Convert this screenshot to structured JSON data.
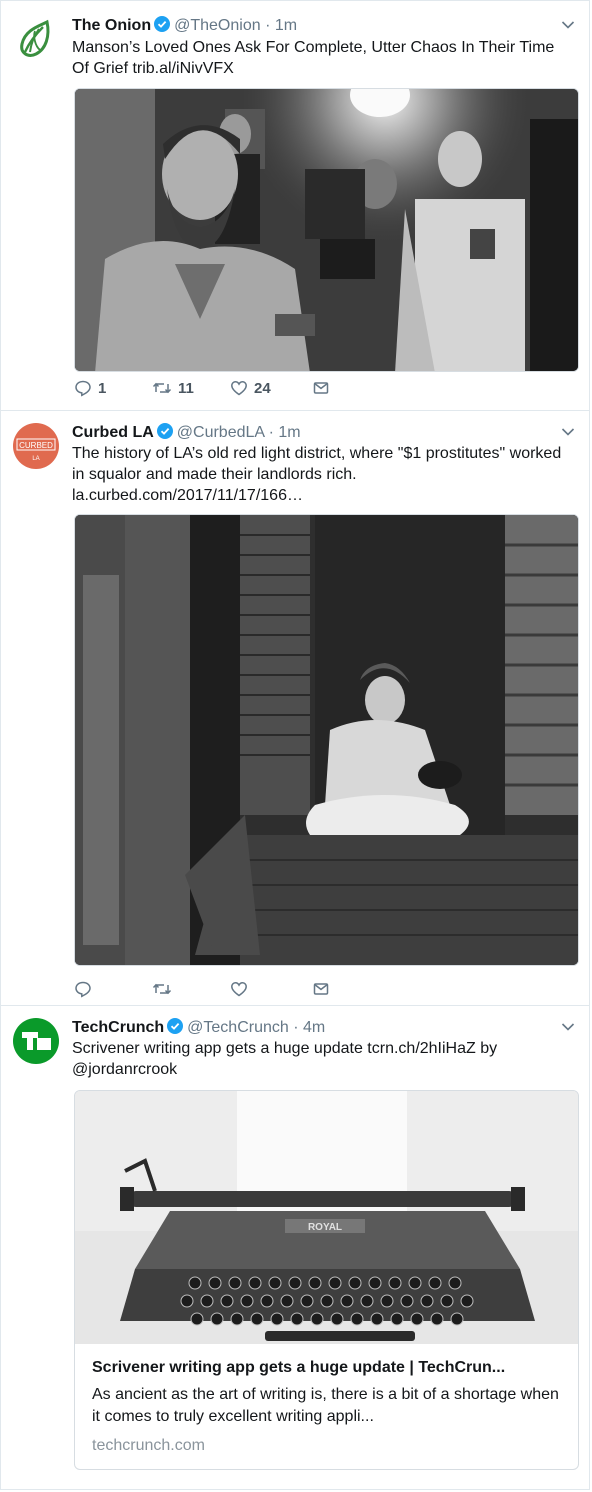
{
  "tweets": [
    {
      "name": "The Onion",
      "handle": "@TheOnion · 1m",
      "text": "Manson’s Loved Ones Ask For Complete, Utter Chaos In Their Time Of Grief ",
      "link": "trib.al/iNivVFX",
      "counts": {
        "reply": "1",
        "retweet": "11",
        "like": "24"
      }
    },
    {
      "name": "Curbed LA",
      "handle": "@CurbedLA · 1m",
      "text": "The history of LA’s old red light district, where \"$1 prostitutes\" worked in squalor and made their landlords rich. ",
      "link": "la.curbed.com/2017/11/17/166…",
      "avatar_top": "CURBED",
      "avatar_bottom": "LA"
    },
    {
      "name": "TechCrunch",
      "handle": "@TechCrunch · 4m",
      "text": "Scrivener writing app gets a huge update ",
      "link": "tcrn.ch/2hIiHaZ",
      "text_after": " by ",
      "mention": "@jordanrcrook",
      "avatar_logo": "TC",
      "card": {
        "title": "Scrivener writing app gets a huge update | TechCrun...",
        "description": "As ancient as the art of writing is, there is a bit of a shortage when it comes to truly excellent writing appli...",
        "domain": "techcrunch.com",
        "typewriter_brand": "ROYAL"
      }
    }
  ],
  "colors": {
    "onion_green": "#3a8f3f",
    "curbed_red": "#e06a4f",
    "techcrunch_green": "#0a9a2a",
    "verified_blue": "#1da1f2"
  },
  "icons": [
    "onion-logo-icon",
    "verified-icon",
    "chevron-down-icon",
    "reply-icon",
    "retweet-icon",
    "like-icon",
    "dm-icon"
  ]
}
